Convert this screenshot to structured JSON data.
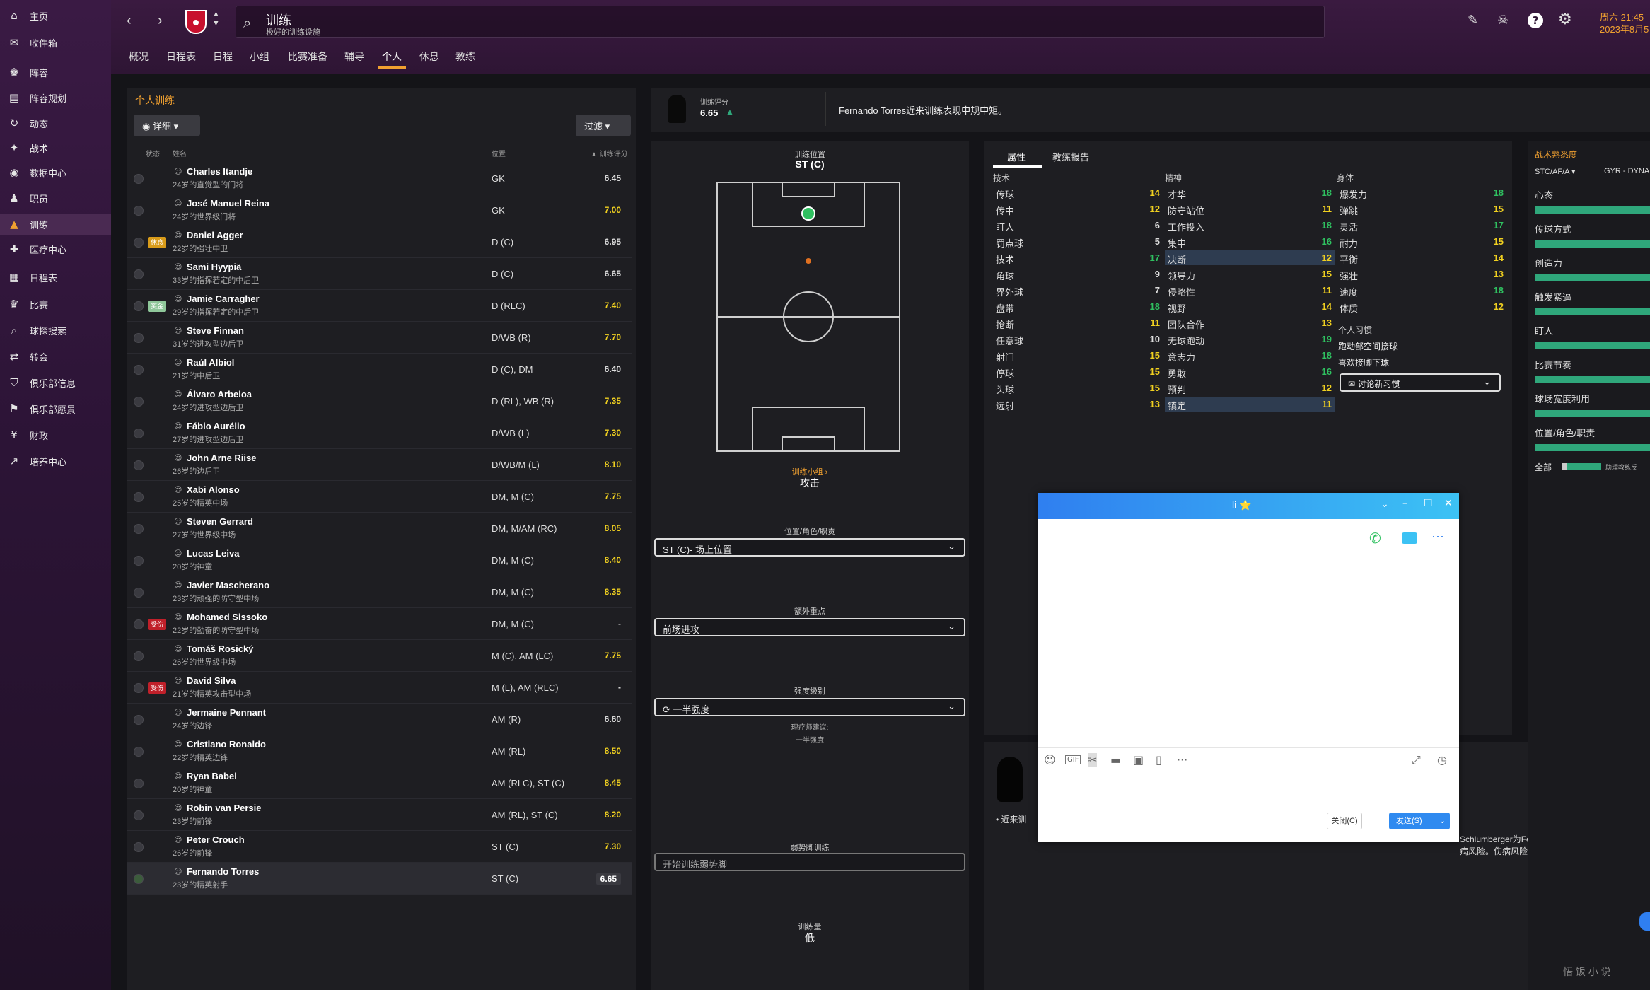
{
  "sidebar": {
    "items": [
      {
        "icon": "⌂",
        "label": "主页"
      },
      {
        "icon": "✉",
        "label": "收件箱"
      },
      {
        "icon": "♚",
        "label": "阵容"
      },
      {
        "icon": "▤",
        "label": "阵容规划"
      },
      {
        "icon": "↻",
        "label": "动态"
      },
      {
        "icon": "✦",
        "label": "战术"
      },
      {
        "icon": "◉",
        "label": "数据中心"
      },
      {
        "icon": "♟",
        "label": "职员"
      },
      {
        "icon": "▲",
        "label": "训练"
      },
      {
        "icon": "✚",
        "label": "医疗中心"
      },
      {
        "icon": "▦",
        "label": "日程表"
      },
      {
        "icon": "♛",
        "label": "比赛"
      },
      {
        "icon": "⌕",
        "label": "球探搜索"
      },
      {
        "icon": "⇄",
        "label": "转会"
      },
      {
        "icon": "⛉",
        "label": "俱乐部信息"
      },
      {
        "icon": "⚑",
        "label": "俱乐部愿景"
      },
      {
        "icon": "¥",
        "label": "财政"
      },
      {
        "icon": "↗",
        "label": "培养中心"
      }
    ]
  },
  "header": {
    "title": "训练",
    "subtitle": "极好的训练设施",
    "date_line1": "周六 21:45",
    "date_line2": "2023年8月5",
    "tabs": [
      "概况",
      "日程表",
      "日程",
      "小组",
      "比赛准备",
      "辅导",
      "个人",
      "休息",
      "教练"
    ]
  },
  "left": {
    "title": "个人训练",
    "detail_btn": "详细",
    "filter_btn": "过滤",
    "col_status": "状态",
    "col_name": "姓名",
    "col_pos": "位置",
    "col_rating": "训练评分",
    "players": [
      {
        "name": "Charles Itandje",
        "desc": "24岁的直觉型的门将",
        "pos": "GK",
        "rating": "6.45",
        "tag": ""
      },
      {
        "name": "José Manuel Reina",
        "desc": "24岁的世界级门将",
        "pos": "GK",
        "rating": "7.00",
        "tag": ""
      },
      {
        "name": "Daniel Agger",
        "desc": "22岁的强壮中卫",
        "pos": "D (C)",
        "rating": "6.95",
        "tag": "休息"
      },
      {
        "name": "Sami Hyypiä",
        "desc": "33岁的指挥若定的中后卫",
        "pos": "D (C)",
        "rating": "6.65",
        "tag": ""
      },
      {
        "name": "Jamie Carragher",
        "desc": "29岁的指挥若定的中后卫",
        "pos": "D (RLC)",
        "rating": "7.40",
        "tag": "奖金"
      },
      {
        "name": "Steve Finnan",
        "desc": "31岁的进攻型边后卫",
        "pos": "D/WB (R)",
        "rating": "7.70",
        "tag": ""
      },
      {
        "name": "Raúl Albiol",
        "desc": "21岁的中后卫",
        "pos": "D (C), DM",
        "rating": "6.40",
        "tag": ""
      },
      {
        "name": "Álvaro Arbeloa",
        "desc": "24岁的进攻型边后卫",
        "pos": "D (RL), WB (R)",
        "rating": "7.35",
        "tag": ""
      },
      {
        "name": "Fábio Aurélio",
        "desc": "27岁的进攻型边后卫",
        "pos": "D/WB (L)",
        "rating": "7.30",
        "tag": ""
      },
      {
        "name": "John Arne Riise",
        "desc": "26岁的边后卫",
        "pos": "D/WB/M (L)",
        "rating": "8.10",
        "tag": ""
      },
      {
        "name": "Xabi Alonso",
        "desc": "25岁的精英中场",
        "pos": "DM, M (C)",
        "rating": "7.75",
        "tag": ""
      },
      {
        "name": "Steven Gerrard",
        "desc": "27岁的世界级中场",
        "pos": "DM, M/AM (RC)",
        "rating": "8.05",
        "tag": ""
      },
      {
        "name": "Lucas Leiva",
        "desc": "20岁的神童",
        "pos": "DM, M (C)",
        "rating": "8.40",
        "tag": ""
      },
      {
        "name": "Javier Mascherano",
        "desc": "23岁的顽强的防守型中场",
        "pos": "DM, M (C)",
        "rating": "8.35",
        "tag": ""
      },
      {
        "name": "Mohamed Sissoko",
        "desc": "22岁的勤奋的防守型中场",
        "pos": "DM, M (C)",
        "rating": "-",
        "tag": "受伤"
      },
      {
        "name": "Tomáš Rosický",
        "desc": "26岁的世界级中场",
        "pos": "M (C), AM (LC)",
        "rating": "7.75",
        "tag": ""
      },
      {
        "name": "David Silva",
        "desc": "21岁的精英攻击型中场",
        "pos": "M (L), AM (RLC)",
        "rating": "-",
        "tag": "受伤"
      },
      {
        "name": "Jermaine Pennant",
        "desc": "24岁的边锋",
        "pos": "AM (R)",
        "rating": "6.60",
        "tag": ""
      },
      {
        "name": "Cristiano Ronaldo",
        "desc": "22岁的精英边锋",
        "pos": "AM (RL)",
        "rating": "8.50",
        "tag": ""
      },
      {
        "name": "Ryan Babel",
        "desc": "20岁的神童",
        "pos": "AM (RLC), ST (C)",
        "rating": "8.45",
        "tag": ""
      },
      {
        "name": "Robin van Persie",
        "desc": "23岁的前锋",
        "pos": "AM (RL), ST (C)",
        "rating": "8.20",
        "tag": ""
      },
      {
        "name": "Peter Crouch",
        "desc": "26岁的前锋",
        "pos": "ST (C)",
        "rating": "7.30",
        "tag": ""
      },
      {
        "name": "Fernando Torres",
        "desc": "23岁的精英射手",
        "pos": "ST (C)",
        "rating": "6.65",
        "tag": ""
      }
    ]
  },
  "rating_panel": {
    "label": "训练评分",
    "value": "6.65",
    "comment": "Fernando Torres近来训练表现中规中矩。"
  },
  "mid": {
    "pos_label": "训练位置",
    "pos_value": "ST (C)",
    "unit_label": "训练小组 ›",
    "unit_value": "攻击",
    "role_label": "位置/角色/职责",
    "role_value": "ST (C)- 场上位置",
    "extra_label": "额外重点",
    "extra_value": "前场进攻",
    "intensity_label": "强度级别",
    "intensity_value": "一半强度",
    "physio_label": "理疗师建议:",
    "physio_value": "一半强度",
    "weak_label": "弱势脚训练",
    "weak_value": "开始训练弱势脚",
    "load_label": "训练量",
    "load_value": "低"
  },
  "right": {
    "tab_attr": "属性",
    "tab_report": "教练报告",
    "h_tech": "技术",
    "h_mental": "精神",
    "h_phys": "身体",
    "tech": [
      [
        "传球",
        "14"
      ],
      [
        "传中",
        "12"
      ],
      [
        "盯人",
        "6"
      ],
      [
        "罚点球",
        "5"
      ],
      [
        "技术",
        "17"
      ],
      [
        "角球",
        "9"
      ],
      [
        "界外球",
        "7"
      ],
      [
        "盘带",
        "18"
      ],
      [
        "抢断",
        "11"
      ],
      [
        "任意球",
        "10"
      ],
      [
        "射门",
        "15"
      ],
      [
        "停球",
        "15"
      ],
      [
        "头球",
        "15"
      ],
      [
        "远射",
        "13"
      ]
    ],
    "mental": [
      [
        "才华",
        "18"
      ],
      [
        "防守站位",
        "11"
      ],
      [
        "工作投入",
        "18"
      ],
      [
        "集中",
        "16"
      ],
      [
        "决断",
        "12"
      ],
      [
        "领导力",
        "15"
      ],
      [
        "侵略性",
        "11"
      ],
      [
        "视野",
        "14"
      ],
      [
        "团队合作",
        "13"
      ],
      [
        "无球跑动",
        "19"
      ],
      [
        "意志力",
        "18"
      ],
      [
        "勇敢",
        "16"
      ],
      [
        "预判",
        "12"
      ],
      [
        "镇定",
        "11"
      ]
    ],
    "phys": [
      [
        "爆发力",
        "18"
      ],
      [
        "弹跳",
        "15"
      ],
      [
        "灵活",
        "17"
      ],
      [
        "耐力",
        "15"
      ],
      [
        "平衡",
        "14"
      ],
      [
        "强壮",
        "13"
      ],
      [
        "速度",
        "18"
      ],
      [
        "体质",
        "12"
      ]
    ],
    "habits_title": "个人习惯",
    "habits": [
      "跑动部空间接球",
      "喜欢接脚下球"
    ],
    "discuss": "讨论新习惯",
    "bottom_note": "近来训",
    "bottom_text": "Schlumberger为Fernando Torres目前的训练量",
    "bottom_text2": "病风险。伤病风险因身体状况和比赛状态差而增加。"
  },
  "far": {
    "title": "战术熟悉度",
    "sel1": "STC/AF/A",
    "sel2": "GYR - DYNA",
    "items": [
      "心态",
      "传球方式",
      "创造力",
      "触发紧逼",
      "盯人",
      "比赛节奏",
      "球场宽度利用",
      "位置/角色/职责"
    ],
    "all": "全部",
    "note": "助理教练反"
  },
  "chat": {
    "title": "li ⭐",
    "close": "关闭(C)",
    "send": "发送(S)"
  },
  "colors": {
    "accent": "#f0a030",
    "green": "#2fa77b"
  }
}
